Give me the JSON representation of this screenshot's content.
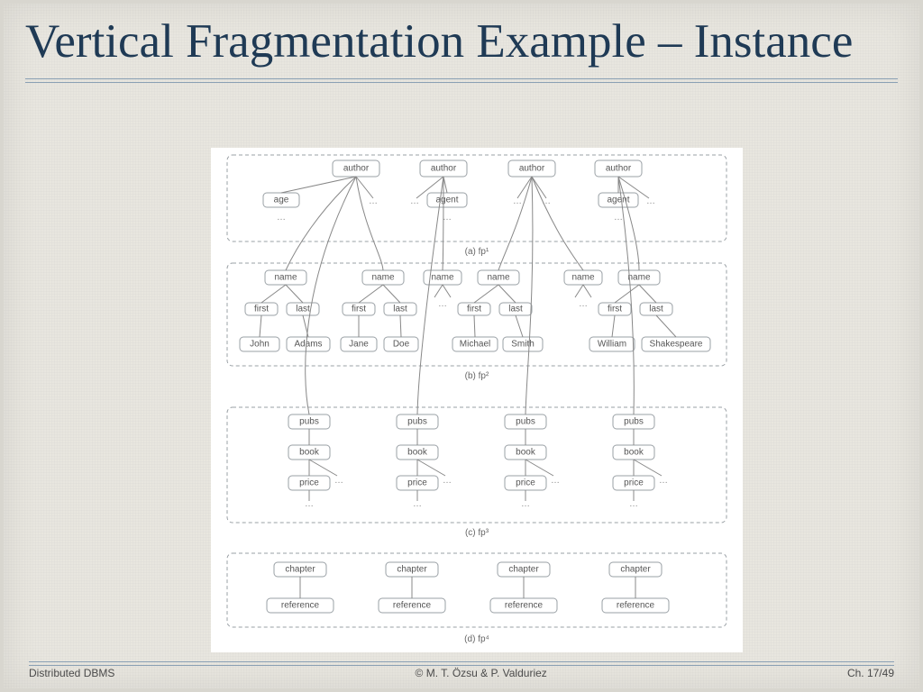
{
  "title": "Vertical Fragmentation Example – Instance",
  "footer": {
    "left": "Distributed DBMS",
    "center": "© M. T. Özsu & P. Valduriez",
    "right": "Ch. 17/49"
  },
  "labels": {
    "author": "author",
    "age": "age",
    "agent": "agent",
    "name": "name",
    "first": "first",
    "last": "last",
    "pubs": "pubs",
    "book": "book",
    "price": "price",
    "chapter": "chapter",
    "reference": "reference",
    "dots": "…"
  },
  "fragments": {
    "a": "(a) fp¹",
    "b": "(b) fp²",
    "c": "(c) fp³",
    "d": "(d) fp⁴"
  },
  "names": {
    "0": {
      "first": "John",
      "last": "Adams"
    },
    "1": {
      "first": "Jane",
      "last": "Doe"
    },
    "2": {
      "first": "Michael",
      "last": "Smith"
    },
    "3": {
      "first": "William",
      "last": "Shakespeare"
    }
  },
  "chart_data": {
    "type": "tree-fragments",
    "fragments": [
      {
        "id": "fp1",
        "roots": [
          "author",
          "author",
          "author",
          "author"
        ],
        "children": {
          "author": [
            "age",
            "agent",
            "…"
          ]
        }
      },
      {
        "id": "fp2",
        "roots": [
          "name",
          "name",
          "name",
          "name",
          "name",
          "name"
        ],
        "children": {
          "name": [
            "first",
            "last"
          ]
        },
        "values": [
          [
            "John",
            "Adams"
          ],
          [
            "Jane",
            "Doe"
          ],
          [
            "Michael",
            "Smith"
          ],
          [
            "William",
            "Shakespeare"
          ]
        ]
      },
      {
        "id": "fp3",
        "roots": [
          "pubs",
          "pubs",
          "pubs",
          "pubs"
        ],
        "children": {
          "pubs": [
            "book"
          ],
          "book": [
            "price",
            "…"
          ]
        }
      },
      {
        "id": "fp4",
        "roots": [
          "chapter",
          "chapter",
          "chapter",
          "chapter"
        ],
        "children": {
          "chapter": [
            "reference"
          ]
        }
      }
    ]
  }
}
